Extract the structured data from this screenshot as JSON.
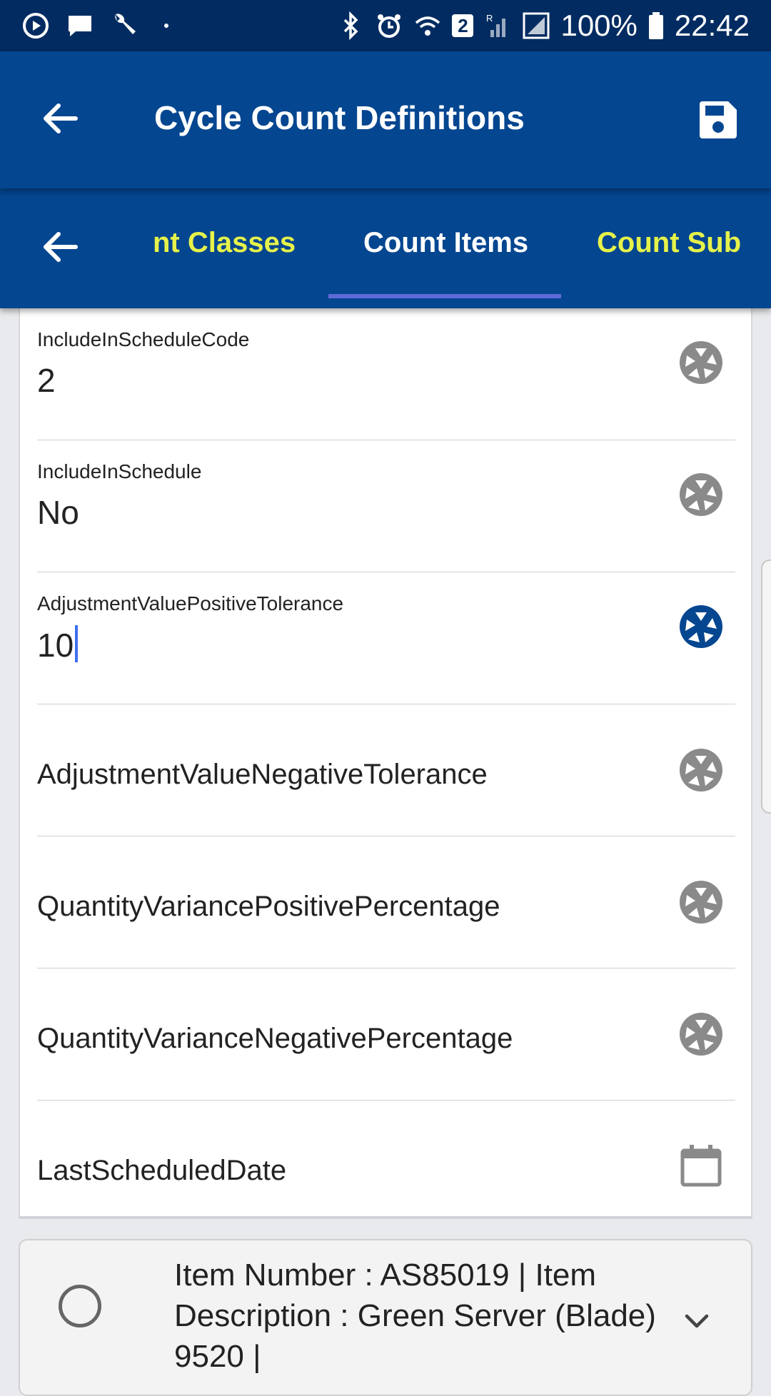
{
  "status_bar": {
    "battery": "100%",
    "time": "22:42",
    "notification_count": "2",
    "roaming": "R"
  },
  "app_bar": {
    "title": "Cycle Count Definitions"
  },
  "tabs": [
    {
      "label": "nt Classes",
      "active": false
    },
    {
      "label": "Count Items",
      "active": true
    },
    {
      "label": "Count Sub",
      "active": false
    }
  ],
  "fields": [
    {
      "label": "IncludeInScheduleCode",
      "value": "2",
      "icon": "camera-shutter-icon"
    },
    {
      "label": "IncludeInSchedule",
      "value": "No",
      "icon": "camera-shutter-icon"
    },
    {
      "label": "AdjustmentValuePositiveTolerance",
      "value": "10",
      "icon": "camera-shutter-icon",
      "focused": true
    },
    {
      "label": "AdjustmentValueNegativeTolerance",
      "value": "",
      "icon": "camera-shutter-icon"
    },
    {
      "label": "QuantityVariancePositivePercentage",
      "value": "",
      "icon": "camera-shutter-icon"
    },
    {
      "label": "QuantityVarianceNegativePercentage",
      "value": "",
      "icon": "camera-shutter-icon"
    },
    {
      "label": "LastScheduledDate",
      "value": "",
      "icon": "calendar-icon"
    }
  ],
  "item_card": {
    "text": "Item Number : AS85019 | Item Description : Green Server (Blade) 9520 |"
  },
  "colors": {
    "status_bar": "#022c61",
    "app_bar": "#044690",
    "tab_inactive": "#e6f24a",
    "tab_active": "#ffffff",
    "tab_indicator": "#5f6bd8",
    "icon_idle": "#8a8a8a",
    "icon_active": "#044690",
    "caret": "#3d6ff0"
  }
}
